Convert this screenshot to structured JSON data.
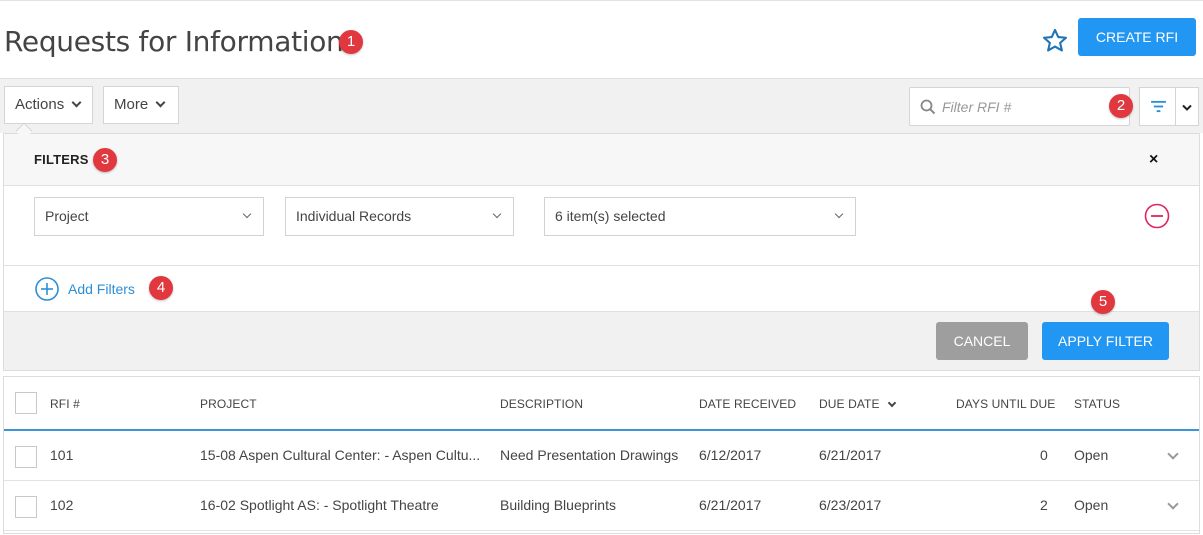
{
  "header": {
    "title": "Requests for Information",
    "create_label": "CREATE RFI"
  },
  "badges": [
    "1",
    "2",
    "3",
    "4",
    "5"
  ],
  "toolbar": {
    "actions_label": "Actions",
    "more_label": "More",
    "search_placeholder": "Filter RFI #"
  },
  "filters": {
    "title": "FILTERS",
    "close_glyph": "×",
    "field_select": "Project",
    "mode_select": "Individual Records",
    "value_select": "6 item(s) selected",
    "add_label": "Add Filters",
    "cancel_label": "CANCEL",
    "apply_label": "APPLY FILTER"
  },
  "table": {
    "headers": {
      "rfi": "RFI #",
      "project": "PROJECT",
      "description": "DESCRIPTION",
      "date_received": "DATE RECEIVED",
      "due_date": "DUE DATE",
      "days_until_due": "DAYS UNTIL DUE",
      "status": "STATUS"
    },
    "rows": [
      {
        "rfi": "101",
        "project": "15-08 Aspen Cultural Center: - Aspen Cultu...",
        "description": "Need Presentation Drawings",
        "date_received": "6/12/2017",
        "due_date": "6/21/2017",
        "days_until_due": "0",
        "status": "Open"
      },
      {
        "rfi": "102",
        "project": "16-02 Spotlight AS: - Spotlight Theatre",
        "description": "Building Blueprints",
        "date_received": "6/21/2017",
        "due_date": "6/23/2017",
        "days_until_due": "2",
        "status": "Open"
      }
    ]
  },
  "icons": {
    "favorite": "star-icon",
    "search": "search-icon",
    "filter": "filter-icon",
    "remove": "remove-circle-icon",
    "add": "add-circle-icon"
  },
  "colors": {
    "primary": "#2196f3",
    "badge": "#e0383e",
    "remove": "#e0245e",
    "cancel": "#9e9e9e"
  }
}
